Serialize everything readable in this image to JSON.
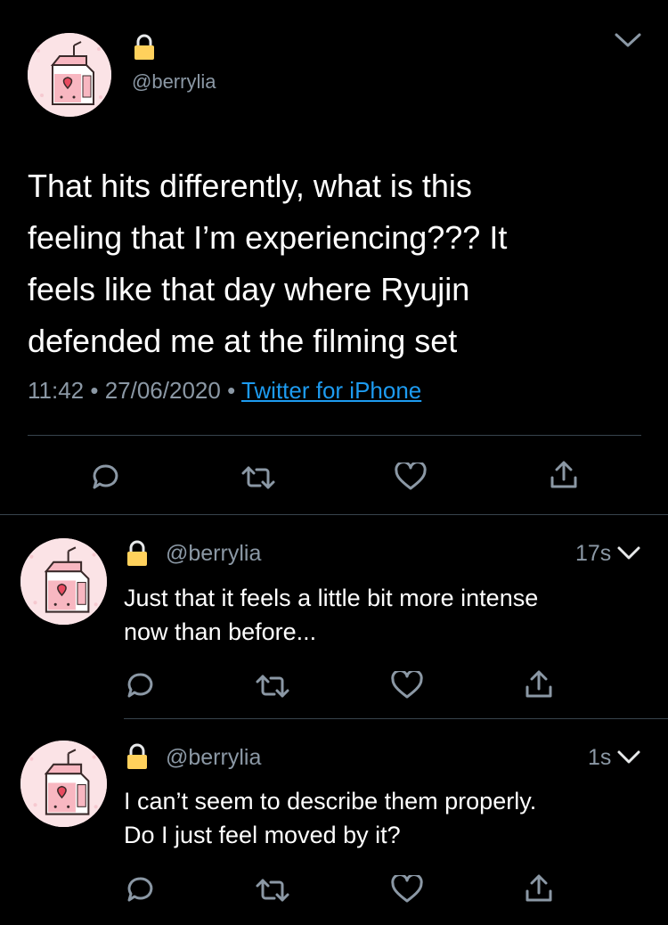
{
  "main_tweet": {
    "handle": "@berrylia",
    "text_lines": [
      "That hits differently, what is this",
      "feeling that I’m experiencing??? It",
      "feels like that day where Ryujin",
      "defended me at the filming set"
    ],
    "time": "11:42",
    "date": "27/06/2020",
    "source": "Twitter for iPhone"
  },
  "replies": [
    {
      "handle": "@berrylia",
      "age": "17s",
      "text_lines": [
        "Just that it feels a little bit more intense",
        "now than before..."
      ]
    },
    {
      "handle": "@berrylia",
      "age": "1s",
      "text_lines": [
        "I can’t seem to describe them properly.",
        "Do I just feel moved by it?"
      ]
    }
  ],
  "icons": [
    "lock-icon",
    "chevron-down-icon",
    "reply-icon",
    "retweet-icon",
    "like-icon",
    "share-icon"
  ],
  "colors": {
    "background": "#000000",
    "muted": "#8b98a5",
    "link": "#1d9bf0",
    "divider": "#38444d"
  }
}
